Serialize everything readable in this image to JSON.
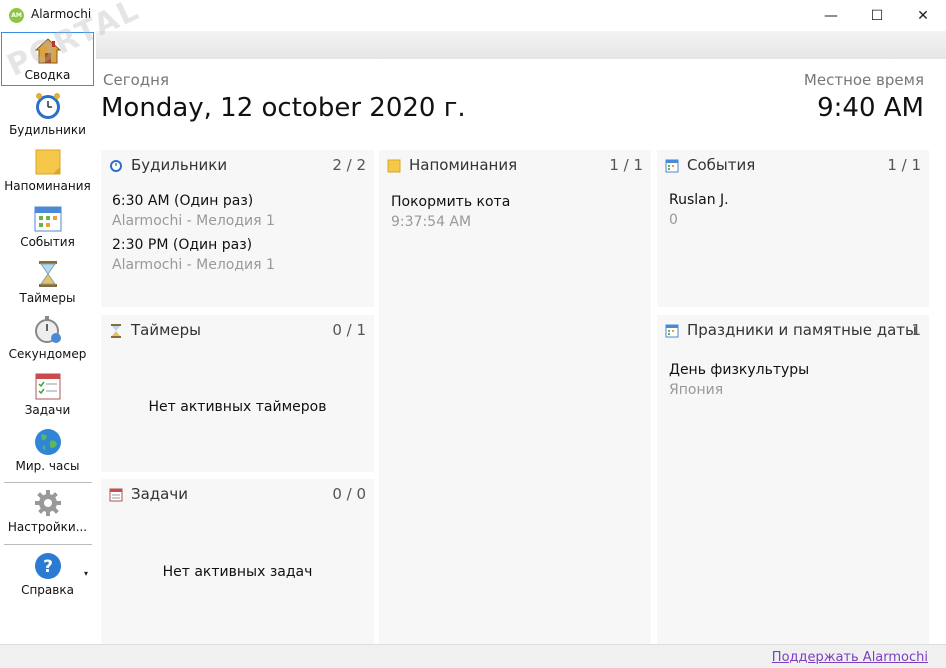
{
  "window": {
    "title": "Alarmochi",
    "app_icon_text": "AM",
    "minimize": "—",
    "maximize": "☐",
    "close": "✕"
  },
  "sidebar": {
    "items": [
      {
        "label": "Сводка",
        "icon": "home-icon"
      },
      {
        "label": "Будильники",
        "icon": "alarm-clock-icon"
      },
      {
        "label": "Напоминания",
        "icon": "sticky-note-icon"
      },
      {
        "label": "События",
        "icon": "calendar-icon"
      },
      {
        "label": "Таймеры",
        "icon": "hourglass-icon"
      },
      {
        "label": "Секундомер",
        "icon": "stopwatch-icon"
      },
      {
        "label": "Задачи",
        "icon": "task-list-icon"
      },
      {
        "label": "Мир. часы",
        "icon": "globe-icon"
      },
      {
        "label": "Настройки...",
        "icon": "gear-icon"
      },
      {
        "label": "Справка",
        "icon": "help-icon"
      }
    ],
    "help_arrow": "▾"
  },
  "header": {
    "today_label": "Сегодня",
    "date": "Monday, 12 october 2020 г.",
    "local_time_label": "Местное время",
    "time": "9:40 AM"
  },
  "panels": {
    "alarms": {
      "title": "Будильники",
      "count": "2 / 2",
      "entries": [
        {
          "main": "6:30 AM (Один раз)",
          "sub": "Alarmochi - Мелодия 1"
        },
        {
          "main": "2:30 PM (Один раз)",
          "sub": "Alarmochi - Мелодия 1"
        }
      ]
    },
    "reminders": {
      "title": "Напоминания",
      "count": "1 / 1",
      "entries": [
        {
          "main": "Покормить кота",
          "sub": "9:37:54 AM"
        }
      ]
    },
    "events": {
      "title": "События",
      "count": "1 / 1",
      "entries": [
        {
          "main": "Ruslan J.",
          "sub": "0"
        }
      ]
    },
    "timers": {
      "title": "Таймеры",
      "count": "0 / 1",
      "empty": "Нет активных таймеров"
    },
    "holidays": {
      "title": "Праздники и памятные даты",
      "count": "1",
      "entries": [
        {
          "main": "День физкультуры",
          "sub": "Япония"
        }
      ]
    },
    "tasks": {
      "title": "Задачи",
      "count": "0 / 0",
      "empty": "Нет активных задач"
    }
  },
  "status": {
    "support_link": "Поддержать Alarmochi"
  },
  "watermark": {
    "text": "PORTAL"
  },
  "colors": {
    "accent": "#3a8ee6",
    "panel_bg": "#f7f7f7",
    "link": "#7b3fc4"
  }
}
